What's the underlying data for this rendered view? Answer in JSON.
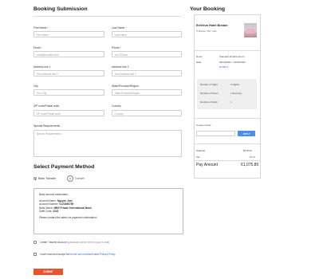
{
  "booking": {
    "title": "Booking Submission",
    "fields": {
      "first_name": {
        "label": "First Name",
        "required": "*",
        "placeholder": "First Name"
      },
      "last_name": {
        "label": "Last Name",
        "required": "*",
        "placeholder": "Last Name"
      },
      "email": {
        "label": "Email",
        "required": "*",
        "placeholder": "email@domain.com"
      },
      "phone": {
        "label": "Phone",
        "required": "*",
        "placeholder": "Your Phone"
      },
      "address1": {
        "label": "Address line 1",
        "placeholder": "Your Address line 1"
      },
      "address2": {
        "label": "Address line 2",
        "placeholder": "Your Address line 2"
      },
      "city": {
        "label": "City",
        "placeholder": "Your City"
      },
      "state": {
        "label": "State/Province/Region",
        "placeholder": "State/Province/Region"
      },
      "zip": {
        "label": "ZIP code/Postal code",
        "placeholder": "ZIP code/Postal code"
      },
      "country": {
        "label": "Country",
        "value": "Country"
      },
      "special": {
        "label": "Special Requirements",
        "placeholder": "Special Requirements"
      }
    }
  },
  "payment": {
    "title": "Select Payment Method",
    "option_label": "Bank Transfer",
    "logo_text": "Transfer",
    "bank_info": {
      "heading": "Bank account information:",
      "account_name_label": "Account Name:",
      "account_name": "Nguyen Jam",
      "account_number_label": "Account Number:",
      "account_number": "0123456789",
      "bank_name_label": "Bank Name:",
      "bank_name": "MBS Private International Bank",
      "swift_label": "Swift Code:",
      "swift": "2233",
      "note": "Please contact the admin for payment confirmation!"
    }
  },
  "checkboxes": {
    "create_account": "Create Traveler account",
    "create_account_note": "(password will be sent to your e-mail)",
    "agree_prefix": "I have read and accept the",
    "terms_link": "terms and conditions",
    "and": "and",
    "privacy_link": "Privacy Policy"
  },
  "submit_label": "SUBMIT",
  "summary": {
    "title": "Your Booking",
    "hotel_name": "EnVieus Hotel Boston",
    "hotel_address": "Boston, MA, USA",
    "room_label": "Room",
    "room_value": "Standard Double Room",
    "date_label": "Date",
    "date_value": "04/16/2022 - 04/18/2022",
    "details_link": "Details",
    "nights_label": "Number of Night",
    "nights_value": "2 Nights",
    "rooms_label": "Number of Room",
    "rooms_value": "1 Room(s)",
    "adult_label": "Number of Adult",
    "adult_value": "1",
    "coupon_label": "Coupon Code",
    "apply_label": "APPLY",
    "subtotal_label": "Subtotal",
    "subtotal_value": "€978.00",
    "tax_label": "Tax",
    "tax_value": "10 %",
    "pay_label": "Pay Amount",
    "pay_value": "€1,075.80"
  },
  "colors": {
    "accent": "#e8542d",
    "link": "#2f6fd1",
    "apply": "#4d8fe6"
  }
}
